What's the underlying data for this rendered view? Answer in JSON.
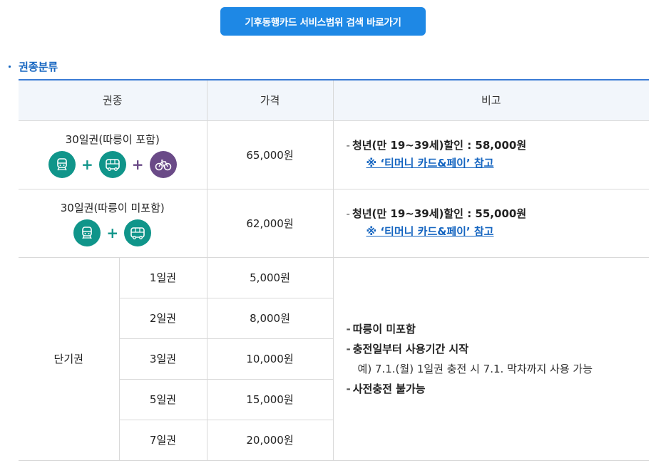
{
  "top_button": {
    "label": "기후동행카드 서비스범위 검색 바로가기"
  },
  "section": {
    "title": "권종분류"
  },
  "table": {
    "headers": [
      "권종",
      "가격",
      "비고"
    ],
    "rows": [
      {
        "name": "30일권(따릉이 포함)",
        "price": "65,000원",
        "note_line": "청년(만 19~39세)할인 : 58,000원",
        "note_link": "※ ‘티머니 카드&페이’ 참고",
        "icons": [
          "subway-icon",
          "bus-icon",
          "bicycle-icon"
        ]
      },
      {
        "name": "30일권(따릉이 미포함)",
        "price": "62,000원",
        "note_line": "청년(만 19~39세)할인 : 55,000원",
        "note_link": "※ ‘티머니 카드&페이’ 참고",
        "icons": [
          "subway-icon",
          "bus-icon"
        ]
      }
    ],
    "short_term": {
      "label": "단기권",
      "items": [
        {
          "duration": "1일권",
          "price": "5,000원"
        },
        {
          "duration": "2일권",
          "price": "8,000원"
        },
        {
          "duration": "3일권",
          "price": "10,000원"
        },
        {
          "duration": "5일권",
          "price": "15,000원"
        },
        {
          "duration": "7일권",
          "price": "20,000원"
        }
      ],
      "notes": {
        "n1": "따릉이 미포함",
        "n2": "충전일부터 사용기간 시작",
        "n2_sub": "예) 7.1.(월) 1일권 충전 시 7.1. 막차까지 사용 가능",
        "n3": "사전충전 불가능"
      }
    }
  },
  "colors": {
    "accent": "#1e88e5",
    "teal": "#10958a",
    "purple": "#6a4a87"
  }
}
